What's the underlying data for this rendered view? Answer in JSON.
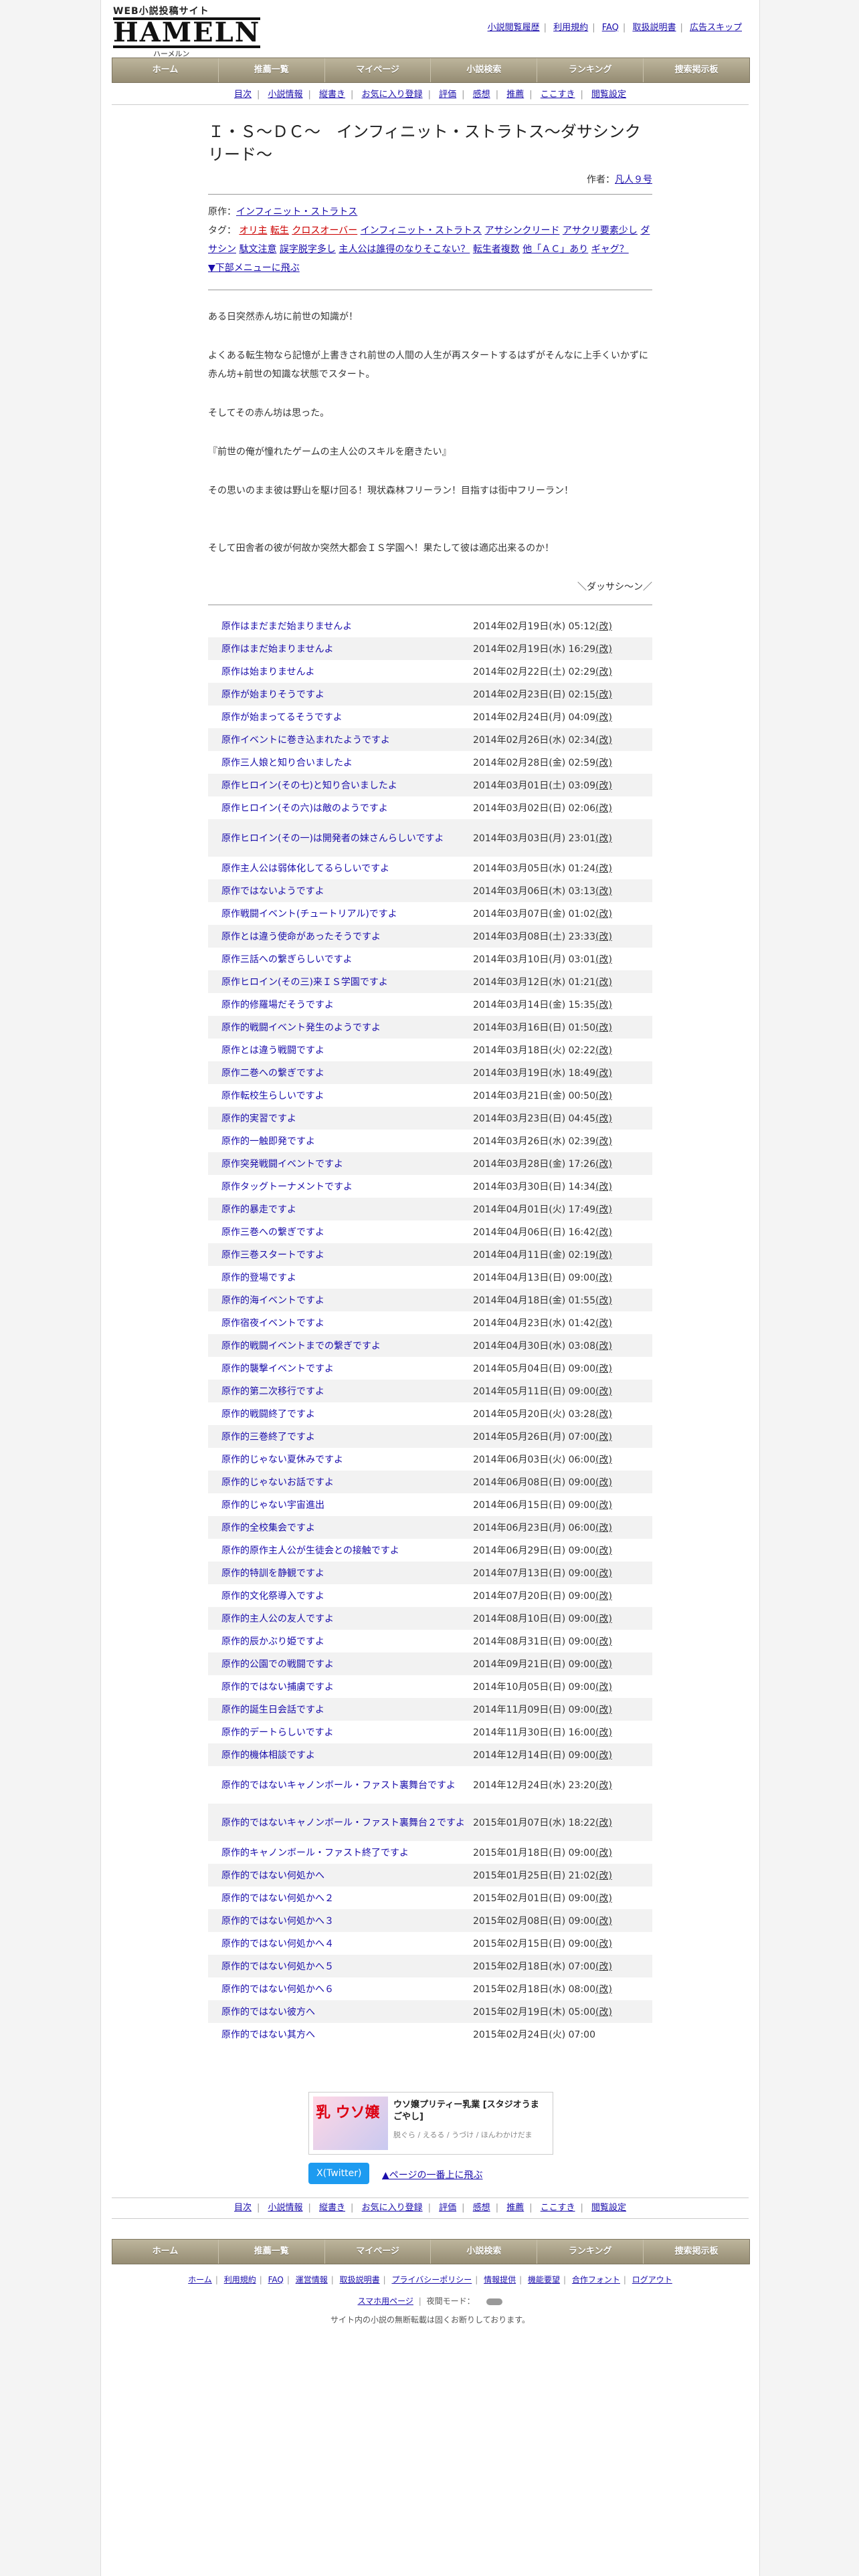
{
  "site": {
    "logo_tagline": "WEB小説投稿サイト",
    "logo_main": "HAMELN",
    "logo_kana": "ハーメルン",
    "top_links": [
      "小説閲覧履歴",
      "利用規約",
      "FAQ",
      "取扱説明書",
      "広告スキップ"
    ],
    "main_nav": [
      "ホーム",
      "推薦一覧",
      "マイページ",
      "小説検索",
      "ランキング",
      "捜索掲示板"
    ],
    "sub_nav": [
      "目次",
      "小説情報",
      "縦書き",
      "お気に入り登録",
      "評価",
      "感想",
      "推薦",
      "ここすき",
      "閲覧設定"
    ]
  },
  "novel": {
    "title": "Ｉ・Ｓ〜ＤＣ〜　インフィニット・ストラトス〜ダサシンクリード〜",
    "author_label": "作者：",
    "author": "凡人９号",
    "original_label": "原作：",
    "original": "インフィニット・ストラトス",
    "tags_label": "タグ：",
    "tags_red": [
      "オリ主",
      "転生",
      "クロスオーバー"
    ],
    "tags_blue": [
      "インフィニット・ストラトス",
      "アサシンクリード",
      "アサクリ要素少し",
      "ダサシン",
      "駄文注意",
      "誤字脱字多し",
      "主人公は誰得のなりそこない？",
      "転生者複数",
      "他「ＡＣ」あり",
      "ギャグ？"
    ],
    "jump_link": "▼下部メニューに飛ぶ"
  },
  "synopsis": {
    "p1": "ある日突然赤ん坊に前世の知識が！",
    "p2": "よくある転生物なら記憶が上書きされ前世の人間の人生が再スタートするはずがそんなに上手くいかずに赤ん坊+前世の知識な状態でスタート。",
    "p3": "そしてその赤ん坊は思った。",
    "p4": "『前世の俺が憧れたゲームの主人公のスキルを磨きたい』",
    "p5": "その思いのまま彼は野山を駆け回る！現状森林フリーラン！目指すは街中フリーラン！",
    "p6": "そして田舎者の彼が何故か突然大都会ＩＳ学園へ！果たして彼は適応出来るのか！",
    "p7": "＼ダッサシ〜ン／"
  },
  "chapters": [
    {
      "t": "原作はまだまだ始まりませんよ",
      "d": "2014年02月19日(水) 05:12",
      "c": "(改)"
    },
    {
      "t": "原作はまだ始まりませんよ",
      "d": "2014年02月19日(水) 16:29",
      "c": "(改)"
    },
    {
      "t": "原作は始まりませんよ",
      "d": "2014年02月22日(土) 02:29",
      "c": "(改)"
    },
    {
      "t": "原作が始まりそうですよ",
      "d": "2014年02月23日(日) 02:15",
      "c": "(改)"
    },
    {
      "t": "原作が始まってるそうですよ",
      "d": "2014年02月24日(月) 04:09",
      "c": "(改)"
    },
    {
      "t": "原作イベントに巻き込まれたようですよ",
      "d": "2014年02月26日(水) 02:34",
      "c": "(改)"
    },
    {
      "t": "原作三人娘と知り合いましたよ",
      "d": "2014年02月28日(金) 02:59",
      "c": "(改)"
    },
    {
      "t": "原作ヒロイン(その七)と知り合いましたよ",
      "d": "2014年03月01日(土) 03:09",
      "c": "(改)"
    },
    {
      "t": "原作ヒロイン(その六)は敵のようですよ",
      "d": "2014年03月02日(日) 02:06",
      "c": "(改)"
    },
    {
      "t": "原作ヒロイン(その一)は開発者の妹さんらしいですよ",
      "d": "2014年03月03日(月) 23:01",
      "c": "(改)"
    },
    {
      "t": "原作主人公は弱体化してるらしいですよ",
      "d": "2014年03月05日(水) 01:24",
      "c": "(改)"
    },
    {
      "t": "原作ではないようですよ",
      "d": "2014年03月06日(木) 03:13",
      "c": "(改)"
    },
    {
      "t": "原作戦闘イベント(チュートリアル)ですよ",
      "d": "2014年03月07日(金) 01:02",
      "c": "(改)"
    },
    {
      "t": "原作とは違う使命があったそうですよ",
      "d": "2014年03月08日(土) 23:33",
      "c": "(改)"
    },
    {
      "t": "原作三話への繋ぎらしいですよ",
      "d": "2014年03月10日(月) 03:01",
      "c": "(改)"
    },
    {
      "t": "原作ヒロイン(その三)来ＩＳ学園ですよ",
      "d": "2014年03月12日(水) 01:21",
      "c": "(改)"
    },
    {
      "t": "原作的修羅場だそうですよ",
      "d": "2014年03月14日(金) 15:35",
      "c": "(改)"
    },
    {
      "t": "原作的戦闘イベント発生のようですよ",
      "d": "2014年03月16日(日) 01:50",
      "c": "(改)"
    },
    {
      "t": "原作とは違う戦闘ですよ",
      "d": "2014年03月18日(火) 02:22",
      "c": "(改)"
    },
    {
      "t": "原作二巻への繋ぎですよ",
      "d": "2014年03月19日(水) 18:49",
      "c": "(改)"
    },
    {
      "t": "原作転校生らしいですよ",
      "d": "2014年03月21日(金) 00:50",
      "c": "(改)"
    },
    {
      "t": "原作的実習ですよ",
      "d": "2014年03月23日(日) 04:45",
      "c": "(改)"
    },
    {
      "t": "原作的一触即発ですよ",
      "d": "2014年03月26日(水) 02:39",
      "c": "(改)"
    },
    {
      "t": "原作突発戦闘イベントですよ",
      "d": "2014年03月28日(金) 17:26",
      "c": "(改)"
    },
    {
      "t": "原作タッグトーナメントですよ",
      "d": "2014年03月30日(日) 14:34",
      "c": "(改)"
    },
    {
      "t": "原作的暴走ですよ",
      "d": "2014年04月01日(火) 17:49",
      "c": "(改)"
    },
    {
      "t": "原作三巻への繋ぎですよ",
      "d": "2014年04月06日(日) 16:42",
      "c": "(改)"
    },
    {
      "t": "原作三巻スタートですよ",
      "d": "2014年04月11日(金) 02:19",
      "c": "(改)"
    },
    {
      "t": "原作的登場ですよ",
      "d": "2014年04月13日(日) 09:00",
      "c": "(改)"
    },
    {
      "t": "原作的海イベントですよ",
      "d": "2014年04月18日(金) 01:55",
      "c": "(改)"
    },
    {
      "t": "原作宿夜イベントですよ",
      "d": "2014年04月23日(水) 01:42",
      "c": "(改)"
    },
    {
      "t": "原作的戦闘イベントまでの繋ぎですよ",
      "d": "2014年04月30日(水) 03:08",
      "c": "(改)"
    },
    {
      "t": "原作的襲撃イベントですよ",
      "d": "2014年05月04日(日) 09:00",
      "c": "(改)"
    },
    {
      "t": "原作的第二次移行ですよ",
      "d": "2014年05月11日(日) 09:00",
      "c": "(改)"
    },
    {
      "t": "原作的戦闘終了ですよ",
      "d": "2014年05月20日(火) 03:28",
      "c": "(改)"
    },
    {
      "t": "原作的三巻終了ですよ",
      "d": "2014年05月26日(月) 07:00",
      "c": "(改)"
    },
    {
      "t": "原作的じゃない夏休みですよ",
      "d": "2014年06月03日(火) 06:00",
      "c": "(改)"
    },
    {
      "t": "原作的じゃないお話ですよ",
      "d": "2014年06月08日(日) 09:00",
      "c": "(改)"
    },
    {
      "t": "原作的じゃない宇宙進出",
      "d": "2014年06月15日(日) 09:00",
      "c": "(改)"
    },
    {
      "t": "原作的全校集会ですよ",
      "d": "2014年06月23日(月) 06:00",
      "c": "(改)"
    },
    {
      "t": "原作的原作主人公が生徒会との接触ですよ",
      "d": "2014年06月29日(日) 09:00",
      "c": "(改)"
    },
    {
      "t": "原作的特訓を静観ですよ",
      "d": "2014年07月13日(日) 09:00",
      "c": "(改)"
    },
    {
      "t": "原作的文化祭導入ですよ",
      "d": "2014年07月20日(日) 09:00",
      "c": "(改)"
    },
    {
      "t": "原作的主人公の友人ですよ",
      "d": "2014年08月10日(日) 09:00",
      "c": "(改)"
    },
    {
      "t": "原作的辰かぶり姫ですよ",
      "d": "2014年08月31日(日) 09:00",
      "c": "(改)"
    },
    {
      "t": "原作的公園での戦闘ですよ",
      "d": "2014年09月21日(日) 09:00",
      "c": "(改)"
    },
    {
      "t": "原作的ではない捕虜ですよ",
      "d": "2014年10月05日(日) 09:00",
      "c": "(改)"
    },
    {
      "t": "原作的誕生日会話ですよ",
      "d": "2014年11月09日(日) 09:00",
      "c": "(改)"
    },
    {
      "t": "原作的デートらしいですよ",
      "d": "2014年11月30日(日) 16:00",
      "c": "(改)"
    },
    {
      "t": "原作的機体相談ですよ",
      "d": "2014年12月14日(日) 09:00",
      "c": "(改)"
    },
    {
      "t": "原作的ではないキャノンボール・ファスト裏舞台ですよ",
      "d": "2014年12月24日(水) 23:20",
      "c": "(改)"
    },
    {
      "t": "原作的ではないキャノンボール・ファスト裏舞台２ですよ",
      "d": "2015年01月07日(水) 18:22",
      "c": "(改)"
    },
    {
      "t": "原作的キャノンボール・ファスト終了ですよ",
      "d": "2015年01月18日(日) 09:00",
      "c": "(改)"
    },
    {
      "t": "原作的ではない何処かへ",
      "d": "2015年01月25日(日) 21:02",
      "c": "(改)"
    },
    {
      "t": "原作的ではない何処かへ２",
      "d": "2015年02月01日(日) 09:00",
      "c": "(改)"
    },
    {
      "t": "原作的ではない何処かへ３",
      "d": "2015年02月08日(日) 09:00",
      "c": "(改)"
    },
    {
      "t": "原作的ではない何処かへ４",
      "d": "2015年02月15日(日) 09:00",
      "c": "(改)"
    },
    {
      "t": "原作的ではない何処かへ５",
      "d": "2015年02月18日(水) 07:00",
      "c": "(改)"
    },
    {
      "t": "原作的ではない何処かへ６",
      "d": "2015年02月18日(水) 08:00",
      "c": "(改)"
    },
    {
      "t": "原作的ではない彼方へ",
      "d": "2015年02月19日(木) 05:00",
      "c": "(改)"
    },
    {
      "t": "原作的ではない其方へ",
      "d": "2015年02月24日(火) 07:00",
      "c": ""
    }
  ],
  "ad": {
    "thumb_text": "乳 ウソ嬢",
    "title": "ウソ嬢プリティー乳業 [スタジオうまごやし]",
    "by": "脱ぐら / えるる / うづけ / ほんわかけだま"
  },
  "share": {
    "x_button": "X(Twitter)",
    "to_top": "▲ページの一番上に飛ぶ"
  },
  "footer": {
    "links": [
      "ホーム",
      "利用規約",
      "FAQ",
      "運営情報",
      "取扱説明書",
      "プライバシーポリシー",
      "情報提供",
      "機能要望",
      "合作フォント",
      "ログアウト"
    ],
    "mobile_label": "スマホ用ページ",
    "night_label": "夜間モード：",
    "copyright": "サイト内の小説の無断転載は固くお断りしております。"
  }
}
